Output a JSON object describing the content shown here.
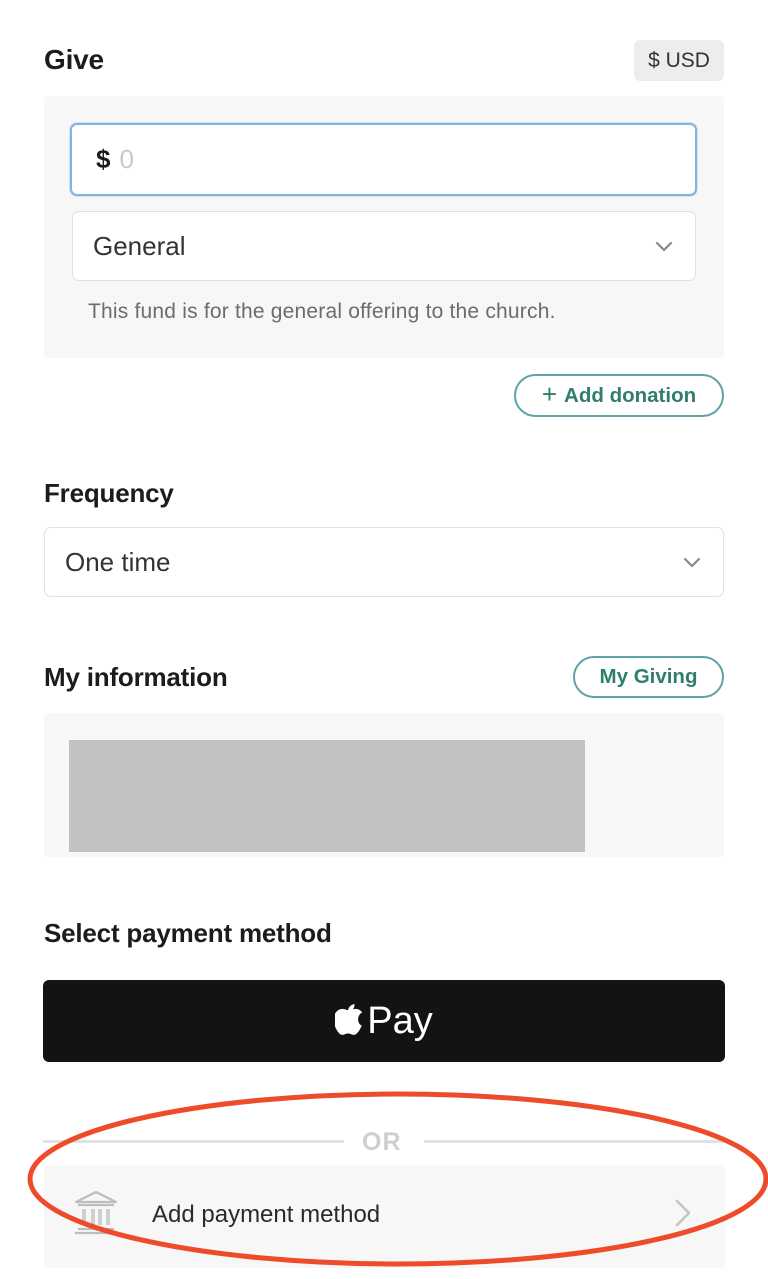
{
  "give": {
    "title": "Give",
    "currency": "$ USD",
    "amount_prefix": "$",
    "amount_placeholder": "0",
    "fund_selected": "General",
    "fund_description": "This fund is for the general offering to the church.",
    "add_donation_label": "Add donation"
  },
  "frequency": {
    "title": "Frequency",
    "selected": "One time"
  },
  "my_information": {
    "title": "My information",
    "my_giving_label": "My Giving"
  },
  "payment": {
    "title": "Select payment method",
    "apple_pay_label": "Pay",
    "or_label": "OR",
    "add_method_label": "Add payment method"
  },
  "icons": {
    "chevron": "chevron-down-icon",
    "plus": "plus-icon",
    "apple": "apple-logo-icon",
    "bank": "bank-icon",
    "chevron_right": "chevron-right-icon"
  },
  "colors": {
    "accent_green": "#2f7e6b",
    "pill_border": "#5fa3a6",
    "focus_blue": "#7fb4e4",
    "highlight_red": "#ee4b2b",
    "apple_pay_bg": "#131313"
  }
}
